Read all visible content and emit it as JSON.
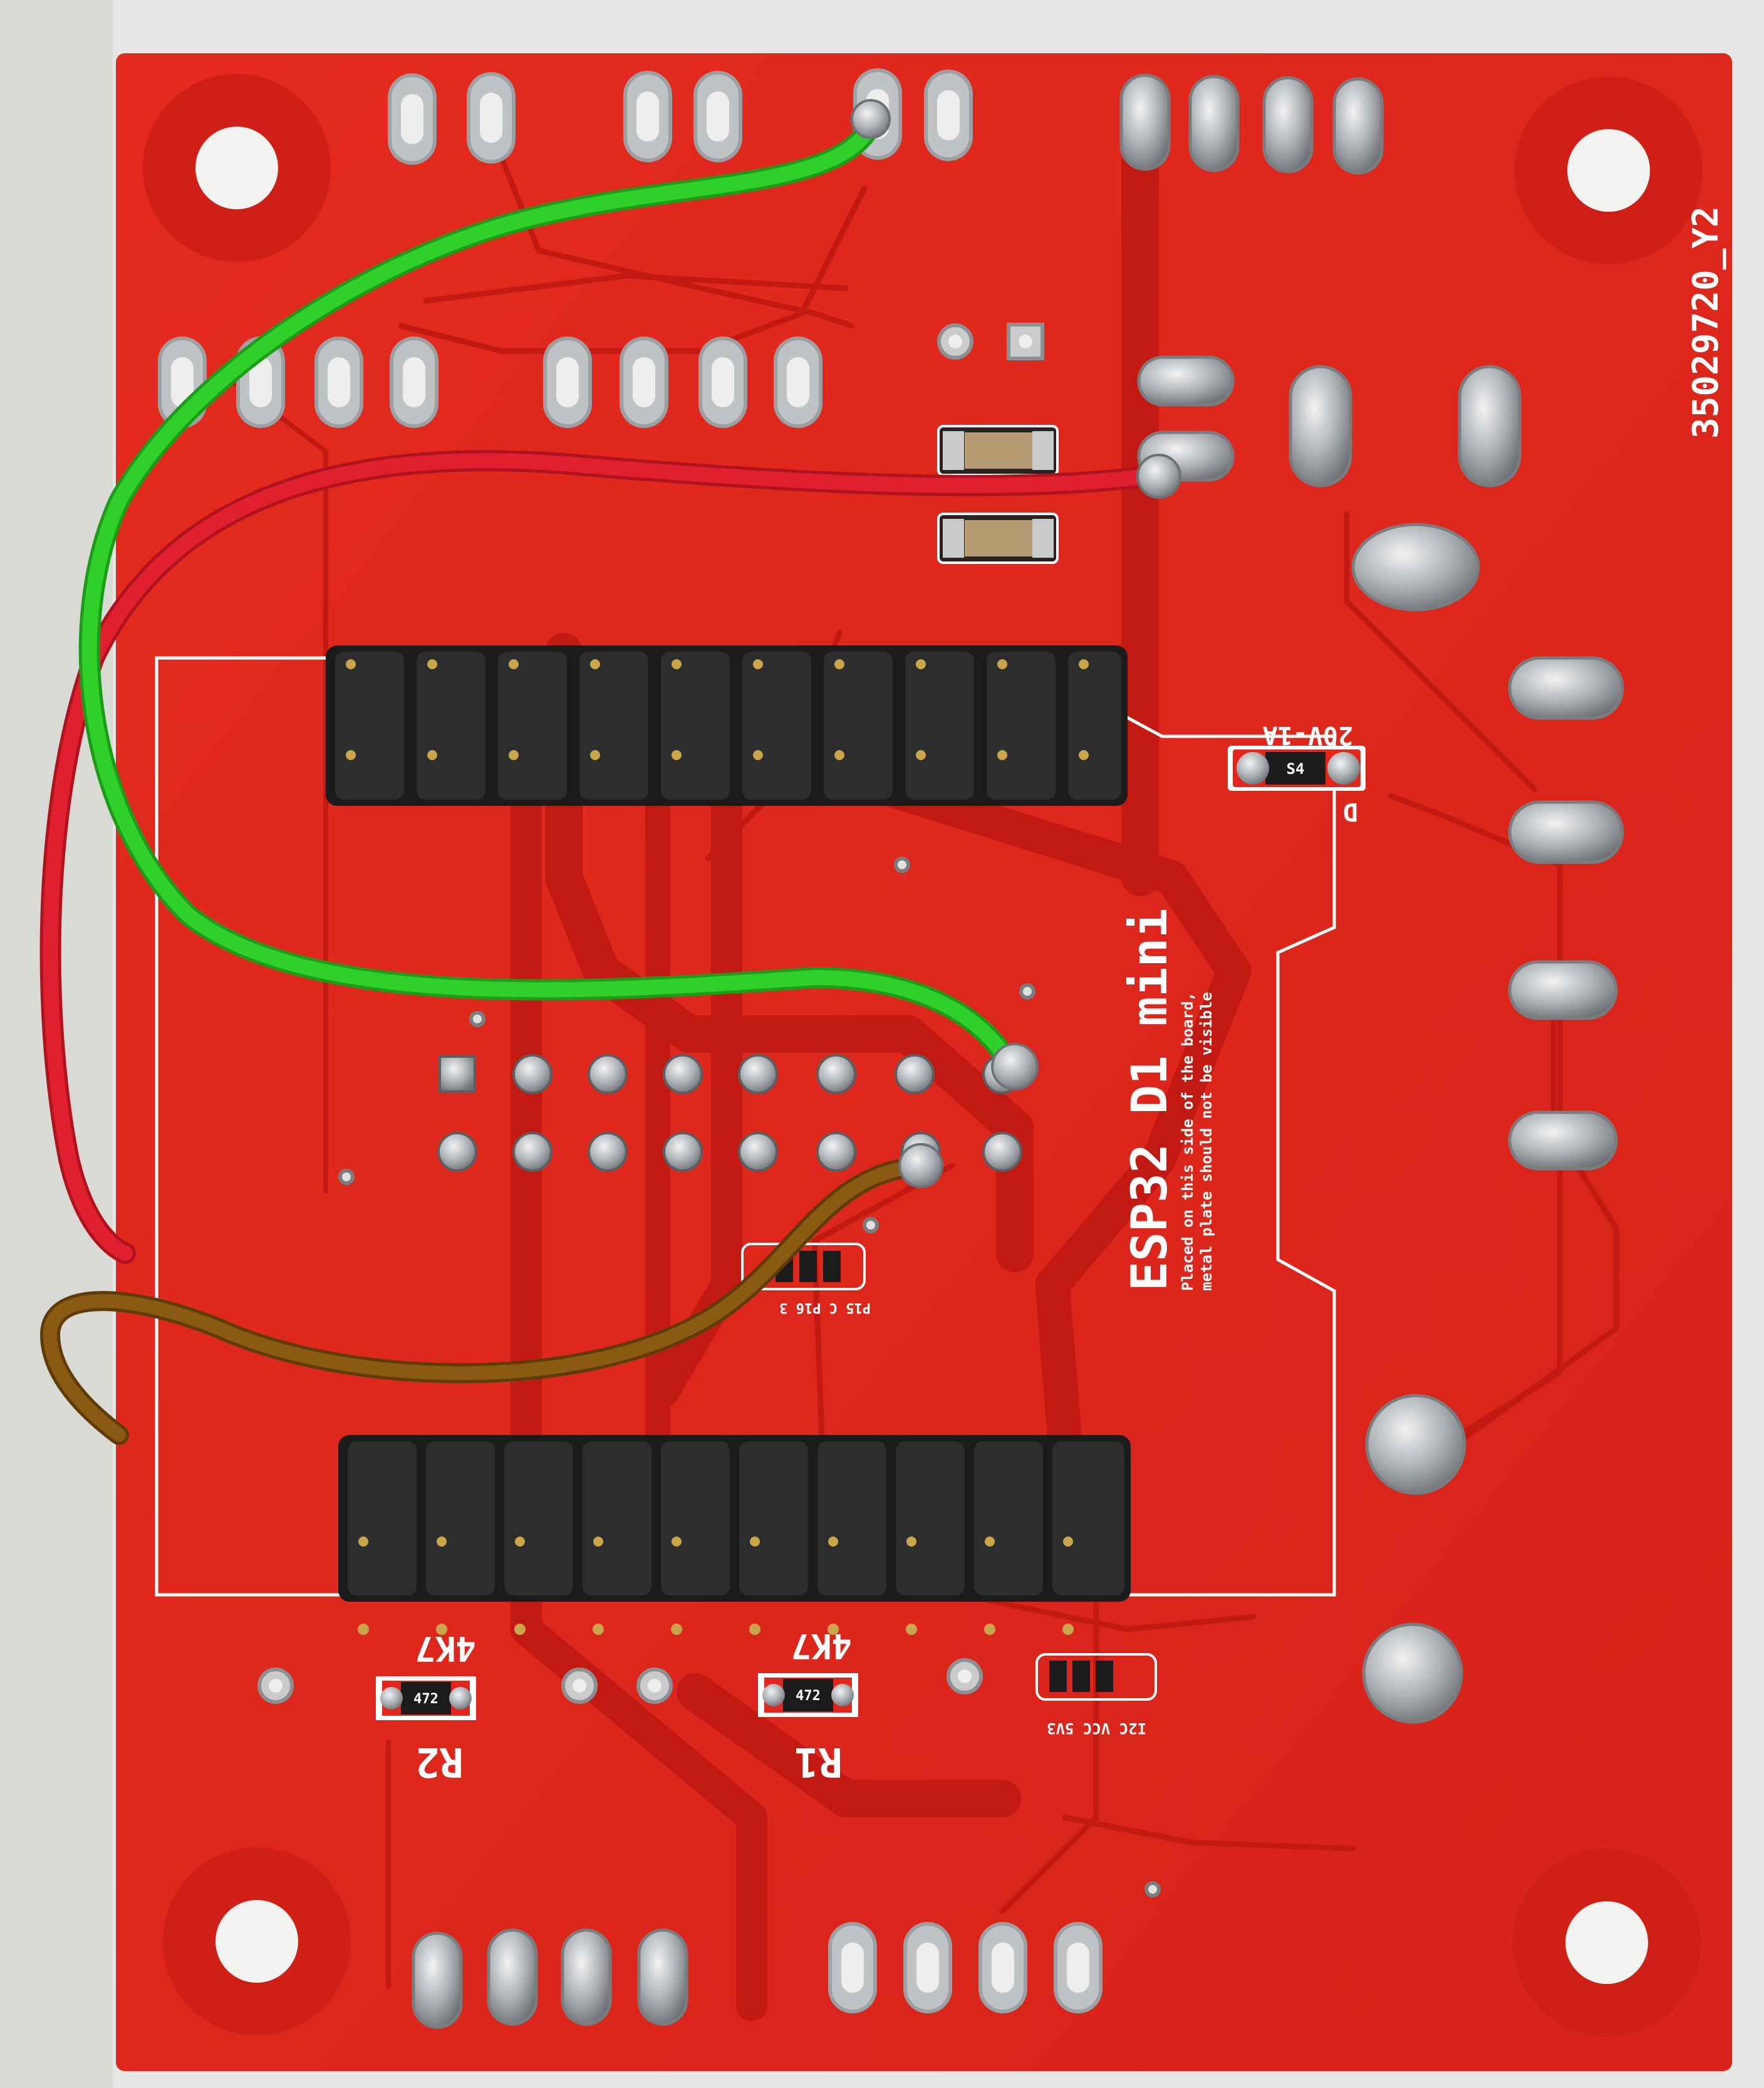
{
  "photo": {
    "subject": "pcb-back-side",
    "colors": {
      "background": "#e6e6e4",
      "board": "#e2261c",
      "board_dark": "#b8160f",
      "trace": "#c91b12",
      "silkscreen": "#ffffff",
      "solder": "#b9bcc0",
      "header_plastic": "#1b1b1b",
      "wire_green": "#2fd02a",
      "wire_red": "#e0202e",
      "wire_brown": "#8a5a12"
    }
  },
  "silkscreen": {
    "board_id": "35029720_Y2",
    "module_name": "ESP32 D1 mini",
    "module_note_1": "Placed on this side of the board,",
    "module_note_2": "metal plate should not be visible",
    "diode_rating": "20V-1A",
    "diode_ref": "D",
    "diode_marking": "S4",
    "r1_value": "4K7",
    "r1_ref": "R1",
    "r1_marking": "472",
    "r2_value": "4K7",
    "r2_ref": "R2",
    "r2_marking": "472",
    "i2c_label": "I2C VCC 5V3",
    "pin_labels": "P15 C P16 3"
  }
}
